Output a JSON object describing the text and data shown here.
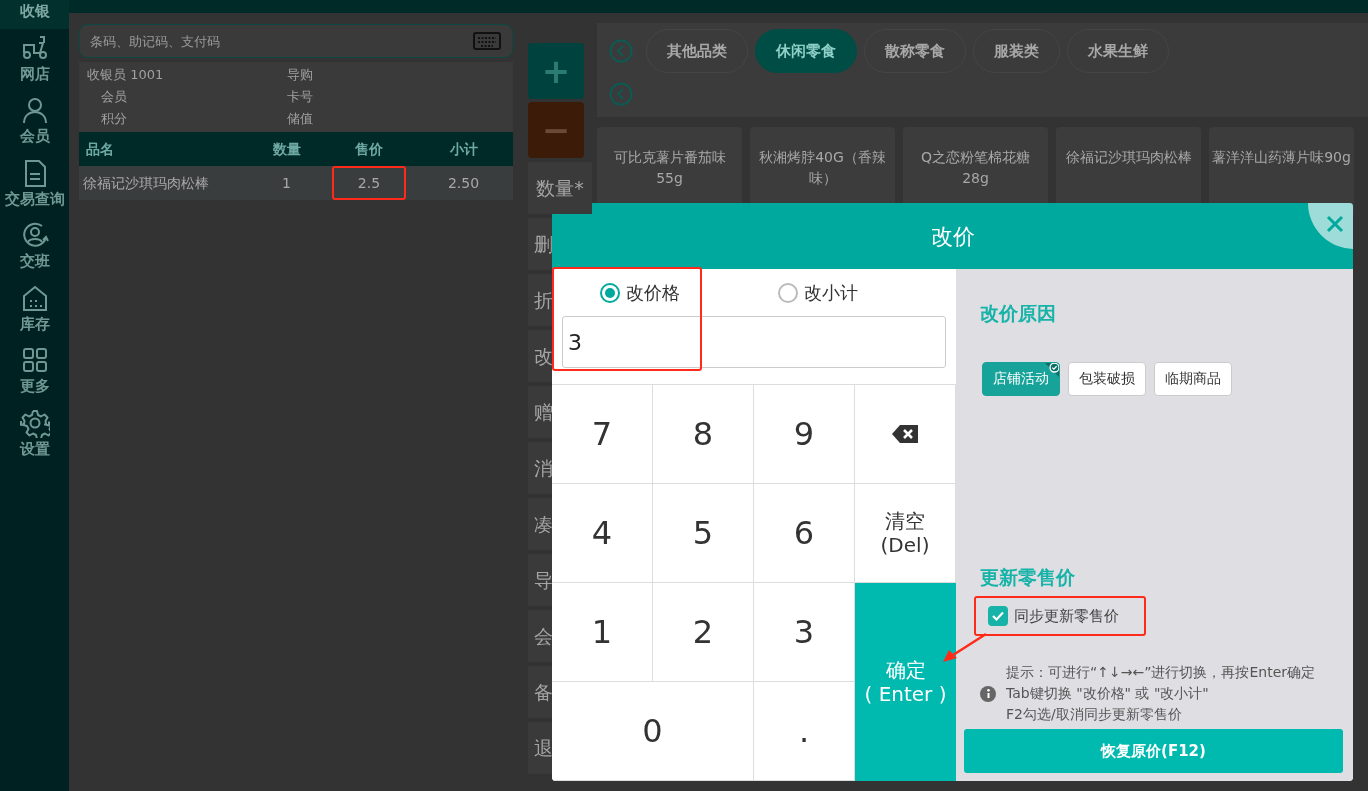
{
  "sidebar": {
    "items": [
      {
        "label": "收银",
        "selected": true
      },
      {
        "label": "网店",
        "selected": false
      },
      {
        "label": "会员",
        "selected": false
      },
      {
        "label": "交易查询",
        "selected": false
      },
      {
        "label": "交班",
        "selected": false
      },
      {
        "label": "库存",
        "selected": false
      },
      {
        "label": "更多",
        "selected": false
      },
      {
        "label": "设置",
        "selected": false
      }
    ]
  },
  "search": {
    "placeholder": "条码、助记码、支付码"
  },
  "info": [
    {
      "label": "收银员",
      "value": "1001"
    },
    {
      "label": "导购"
    },
    {
      "label": "会员"
    },
    {
      "label": "卡号"
    },
    {
      "label": "积分"
    },
    {
      "label": "储值"
    }
  ],
  "cart": {
    "columns": [
      "品名",
      "数量",
      "售价",
      "小计"
    ],
    "rows": [
      {
        "cells": [
          {
            "text": "徐福记沙琪玛肉松棒",
            "highlighted": false
          },
          {
            "text": "1",
            "highlighted": false
          },
          {
            "text": "2.5",
            "highlighted": true
          },
          {
            "text": "2.50",
            "highlighted": false
          }
        ]
      }
    ]
  },
  "actions": {
    "plus": "+",
    "minus": "−",
    "items": [
      "数量*",
      "删",
      "折",
      "改",
      "赠",
      "消",
      "凑",
      "导",
      "会",
      "备",
      "退"
    ]
  },
  "categories": [
    {
      "label": "其他品类",
      "selected": false
    },
    {
      "label": "休闲零食",
      "selected": true
    },
    {
      "label": "散称零食",
      "selected": false
    },
    {
      "label": "服装类",
      "selected": false
    },
    {
      "label": "水果生鲜",
      "selected": false
    }
  ],
  "products": [
    "可比克薯片番茄味55g",
    "秋湘烤脖40G（香辣味）",
    "Q之恋粉笔棉花糖28g",
    "徐福记沙琪玛肉松棒",
    "薯洋洋山药薄片味90g"
  ],
  "dialog": {
    "title": "改价",
    "modes": [
      {
        "label": "改价格",
        "selected": true
      },
      {
        "label": "改小计",
        "selected": false
      }
    ],
    "modes_highlighted": true,
    "price_input": "3",
    "keys": [
      {
        "kind": "digit",
        "label": "7"
      },
      {
        "kind": "digit",
        "label": "8"
      },
      {
        "kind": "digit",
        "label": "9"
      },
      {
        "kind": "backspace"
      },
      {
        "kind": "digit",
        "label": "4"
      },
      {
        "kind": "digit",
        "label": "5"
      },
      {
        "kind": "digit",
        "label": "6"
      },
      {
        "kind": "clear",
        "label": "清空",
        "sublabel": "(Del)"
      },
      {
        "kind": "digit",
        "label": "1"
      },
      {
        "kind": "digit",
        "label": "2"
      },
      {
        "kind": "digit",
        "label": "3"
      },
      {
        "kind": "confirm",
        "label": "确定",
        "sublabel": "( Enter )"
      },
      {
        "kind": "digit",
        "label": "0",
        "wide": true
      },
      {
        "kind": "digit",
        "label": "."
      }
    ],
    "reason_title": "改价原因",
    "reasons": [
      {
        "label": "店铺活动",
        "selected": true
      },
      {
        "label": "包装破损",
        "selected": false
      },
      {
        "label": "临期商品",
        "selected": false
      }
    ],
    "update_title": "更新零售价",
    "sync": {
      "label": "同步更新零售价",
      "checked": true,
      "highlighted": true
    },
    "annotation_arrow": true,
    "tips": [
      "提示：可进行“↑↓→←”进行切换，再按Enter确定",
      "Tab键切换 \"改价格\" 或 \"改小计\"",
      "F2勾选/取消同步更新零售价"
    ],
    "restore_button": "恢复原价(F12)"
  }
}
